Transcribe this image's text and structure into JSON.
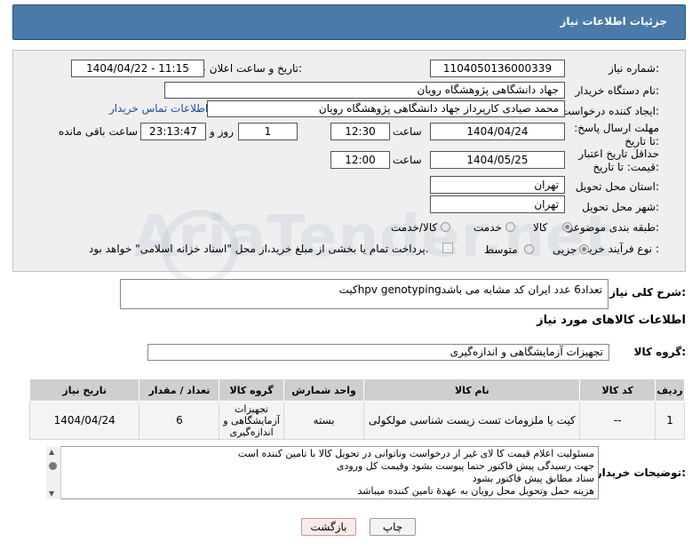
{
  "header": {
    "title": "جزئیات اطلاعات نیاز"
  },
  "form": {
    "need_number_label": "شماره نیاز:",
    "need_number": "1104050136000339",
    "announce_label": "تاریخ و ساعت اعلان عمومی:",
    "announce_value": "1404/04/22 - 11:15",
    "buyer_org_label": "نام دستگاه خریدار:",
    "buyer_org": "جهاد دانشگاهی پژوهشگاه رویان",
    "creator_label": "ایجاد کننده درخواست:",
    "creator": "محمد صیادی کارپرداز جهاد دانشگاهی پژوهشگاه رویان",
    "contact_link": "اطلاعات تماس خریدار",
    "deadline_label": "مهلت ارسال پاسخ: تا تاریخ:",
    "deadline_date": "1404/04/24",
    "time_label": "ساعت",
    "deadline_time": "12:30",
    "days": "1",
    "days_label": "روز و",
    "remaining": "23:13:47",
    "remaining_label": "ساعت باقی مانده",
    "validity_label": "حداقل تاریخ اعتبار قیمت: تا تاریخ:",
    "validity_date": "1404/05/25",
    "validity_time": "12:00",
    "province_label": "استان محل تحویل:",
    "province": "تهران",
    "city_label": "شهر محل تحویل:",
    "city": "تهران",
    "category_label": "طبقه بندی موضوعی:",
    "category_options": [
      "کالا",
      "خدمت",
      "کالا/خدمت"
    ],
    "process_label": "نوع فرآیند خرید :",
    "process_options": [
      "جزیی",
      "متوسط"
    ],
    "payment_note": "پرداخت تمام یا بخشی از مبلغ خرید،از محل \"اسناد خزانه اسلامی\" خواهد بود."
  },
  "watermark": "AriaTender.net",
  "general": {
    "label": "شرح کلی نیاز:",
    "value": "کیتhpv genotypingتعداد6 عدد ایران کد مشابه می باشد"
  },
  "goods_section": {
    "title": "اطلاعات کالاهای مورد نیاز",
    "group_label": "گروه کالا:",
    "group_value": "تجهیزات آزمایشگاهی و اندازه‌گیری"
  },
  "table": {
    "headers": [
      "ردیف",
      "کد کالا",
      "نام کالا",
      "واحد شمارش",
      "گروه کالا",
      "تعداد / مقدار",
      "تاریخ نیاز"
    ],
    "row": {
      "index": "1",
      "code": "--",
      "name": "کیت یا ملزومات تست زیست شناسی مولکولی",
      "unit": "بسته",
      "group": "تجهیزات آزمایشگاهی و اندازه‌گیری",
      "qty": "6",
      "date": "1404/04/24"
    }
  },
  "notes": {
    "label": "توضیحات خریدار:",
    "lines": [
      "مسئولیت اعلام قیمت کا لای  غیر از درخواست وناتوانی در تحویل کالا با تامین کننده است",
      "جهت رسیدگی پیش فاکتور حتما پیوست بشود وقیمت کل ورودی",
      "ستاد مطابق پیش فاکتور بشود",
      "هزینه حمل وتحویل محل رویان به عهدهٔ تامین کننده میباشد"
    ]
  },
  "buttons": {
    "print": "چاپ",
    "back": "بازگشت"
  }
}
